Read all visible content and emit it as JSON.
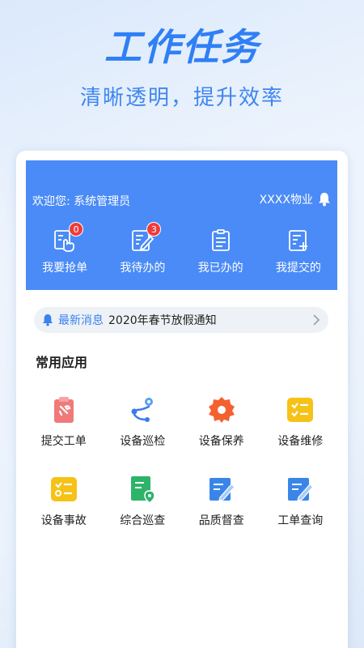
{
  "hero": {
    "title": "工作任务",
    "subtitle": "清晰透明，提升效率"
  },
  "header": {
    "welcome": "欢迎您: 系统管理员",
    "company": "XXXX物业",
    "bell_icon": "bell-icon",
    "background": "#4a8bf7"
  },
  "quick_actions": [
    {
      "label": "我要抢单",
      "icon": "grab-order-icon",
      "badge": "0"
    },
    {
      "label": "我待办的",
      "icon": "todo-icon",
      "badge": "3"
    },
    {
      "label": "我已办的",
      "icon": "done-icon",
      "badge": null
    },
    {
      "label": "我提交的",
      "icon": "submitted-icon",
      "badge": null
    }
  ],
  "notice": {
    "tag": "最新消息",
    "text": "2020年春节放假通知",
    "icon": "bell-icon",
    "arrow": "chevron-right-icon"
  },
  "apps": {
    "title": "常用应用",
    "items": [
      {
        "label": "提交工单",
        "icon": "clipboard-wrench-icon",
        "color": "#f07a7a"
      },
      {
        "label": "设备巡检",
        "icon": "route-icon",
        "color": "#3a7bea"
      },
      {
        "label": "设备保养",
        "icon": "gear-icon",
        "color": "#f4612f"
      },
      {
        "label": "设备维修",
        "icon": "checklist-icon",
        "color": "#f6c218"
      },
      {
        "label": "设备事故",
        "icon": "checklist-alert-icon",
        "color": "#f6c218"
      },
      {
        "label": "综合巡查",
        "icon": "document-location-icon",
        "color": "#2db46a"
      },
      {
        "label": "品质督查",
        "icon": "document-edit-icon",
        "color": "#3a86e8"
      },
      {
        "label": "工单查询",
        "icon": "document-search-icon",
        "color": "#3a86e8"
      }
    ]
  }
}
